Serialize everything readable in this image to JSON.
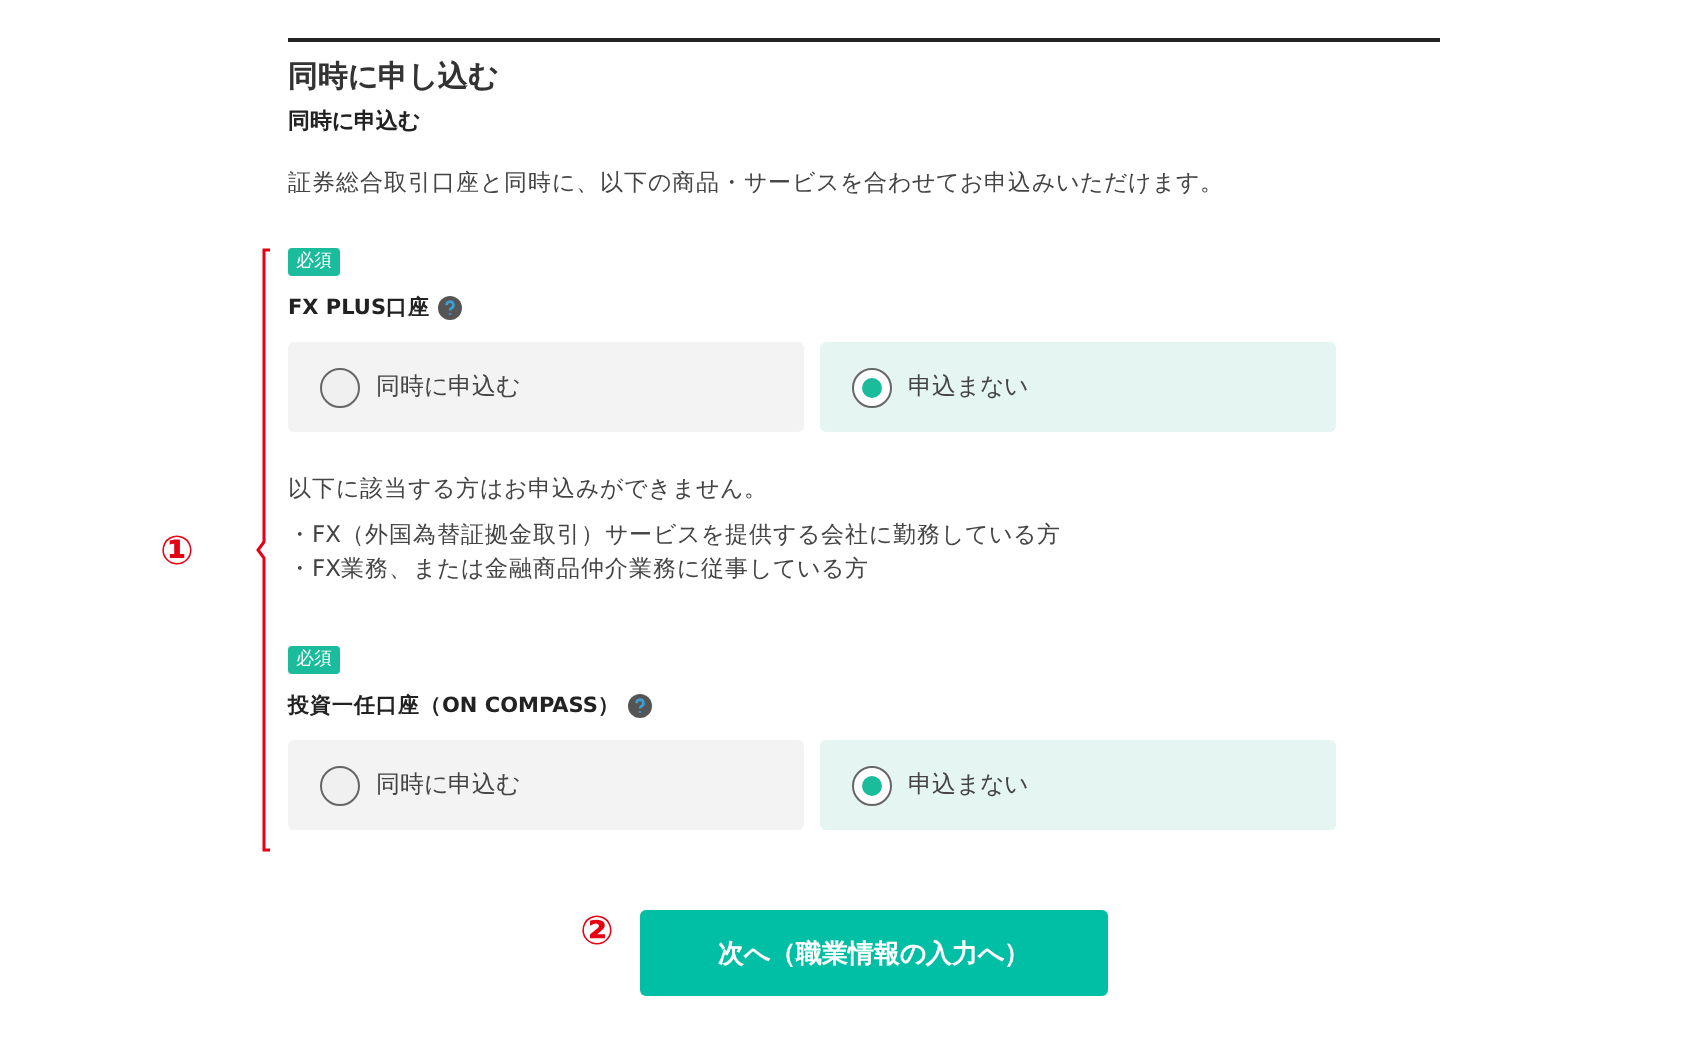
{
  "heading": "同時に申し込む",
  "subheading": "同時に申込む",
  "description": "証券総合取引口座と同時に、以下の商品・サービスを合わせてお申込みいただけます。",
  "annotation_1": "①",
  "products": [
    {
      "badge": "必須",
      "label": "FX PLUS口座",
      "options": [
        {
          "label": "同時に申込む",
          "selected": false
        },
        {
          "label": "申込まない",
          "selected": true
        }
      ],
      "notice": "以下に該当する方はお申込みができません。",
      "conditions": [
        "・FX（外国為替証拠金取引）サービスを提供する会社に勤務している方",
        "・FX業務、または金融商品仲介業務に従事している方"
      ]
    },
    {
      "badge": "必須",
      "label": "投資一任口座（ON COMPASS）",
      "options": [
        {
          "label": "同時に申込む",
          "selected": false
        },
        {
          "label": "申込まない",
          "selected": true
        }
      ]
    }
  ],
  "annotation_2": "②",
  "next_button": "次へ（職業情報の入力へ）"
}
